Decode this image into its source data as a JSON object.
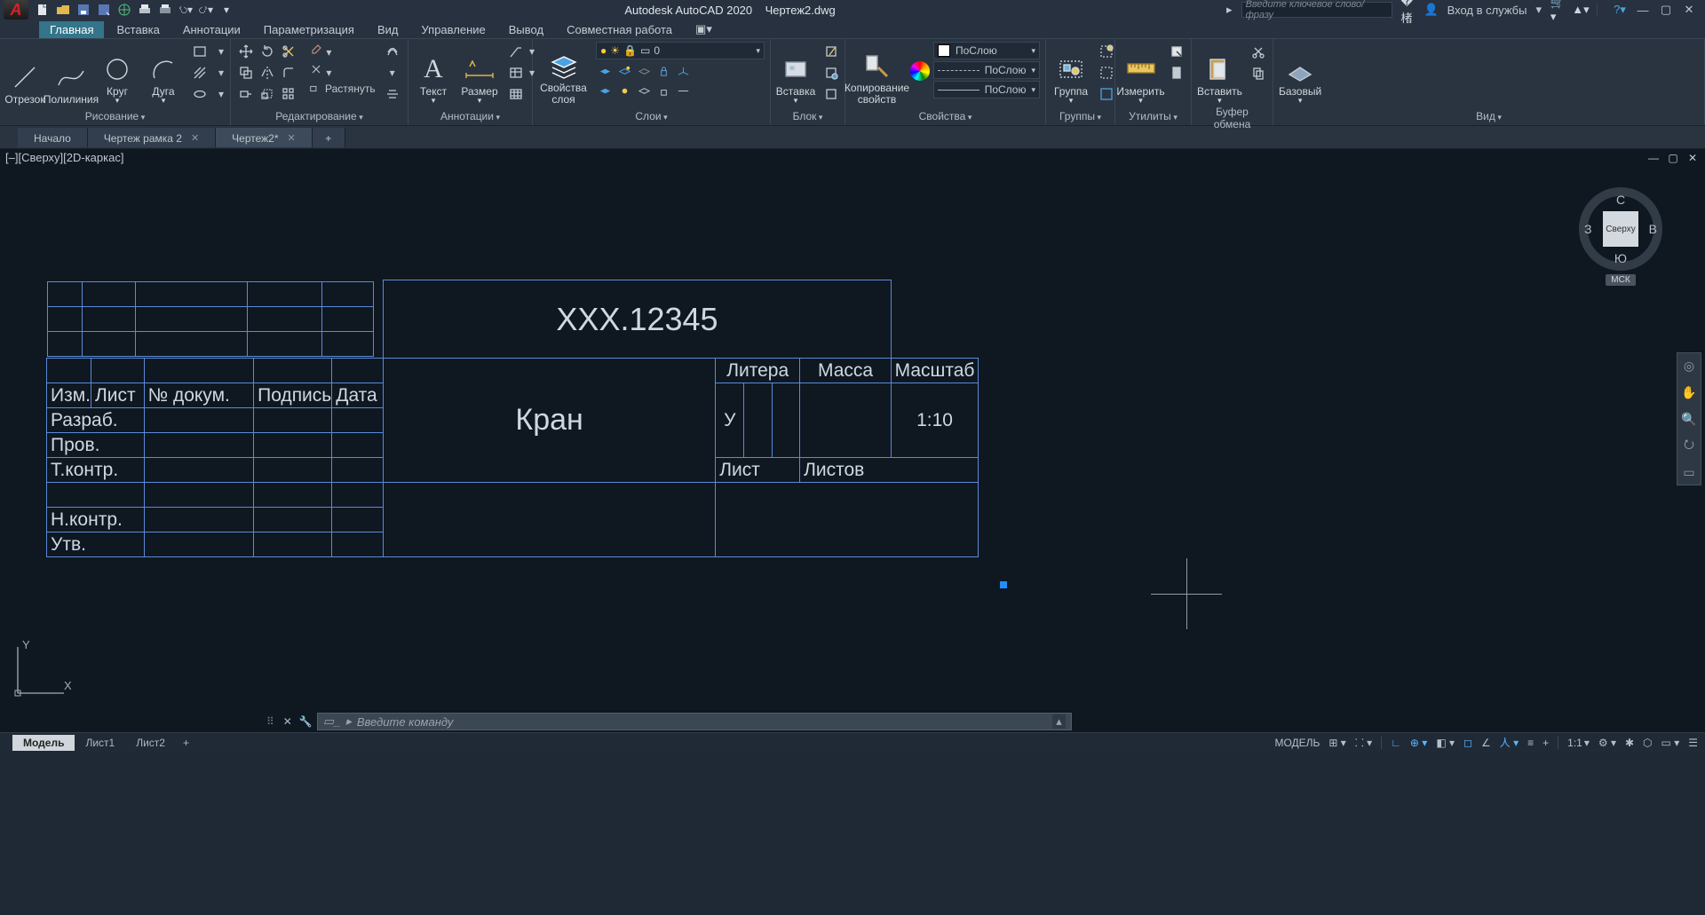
{
  "app": {
    "name": "Autodesk AutoCAD 2020",
    "file": "Чертеж2.dwg"
  },
  "search": {
    "placeholder": "Введите ключевое слово/фразу",
    "login": "Вход в службы"
  },
  "ribbon_tabs": [
    "Главная",
    "Вставка",
    "Аннотации",
    "Параметризация",
    "Вид",
    "Управление",
    "Вывод",
    "Совместная работа"
  ],
  "panels": {
    "draw": {
      "title": "Рисование",
      "line": "Отрезок",
      "pline": "Полилиния",
      "circle": "Круг",
      "arc": "Дуга"
    },
    "edit": {
      "title": "Редактирование",
      "stretch": "Растянуть"
    },
    "anno": {
      "title": "Аннотации",
      "text": "Текст",
      "dim": "Размер"
    },
    "layers": {
      "title": "Слои",
      "props": "Свойства слоя",
      "cur": "0"
    },
    "block": {
      "title": "Блок",
      "insert": "Вставка"
    },
    "props": {
      "title": "Свойства",
      "match": "Копирование свойств",
      "bylayer": "ПоСлою"
    },
    "groups": {
      "title": "Группы",
      "group": "Группа"
    },
    "utils": {
      "title": "Утилиты",
      "measure": "Измерить"
    },
    "clip": {
      "title": "Буфер обмена",
      "paste": "Вставить"
    },
    "view": {
      "title": "Вид",
      "base": "Базовый"
    }
  },
  "doctabs": {
    "start": "Начало",
    "t1": "Чертеж рамка 2",
    "t2": "Чертеж2*"
  },
  "viewport": {
    "label": "[–][Сверху][2D-каркас]",
    "cube": {
      "top": "Сверху",
      "n": "С",
      "s": "Ю",
      "w": "З",
      "e": "В",
      "wcs": "МСК"
    }
  },
  "titleblock": {
    "code": "XXX.12345",
    "name": "Кран",
    "izm": "Изм.",
    "list": "Лист",
    "docno": "№ докум.",
    "sign": "Подпись",
    "date": "Дата",
    "razrab": "Разраб.",
    "prov": "Пров.",
    "tkontr": "Т.контр.",
    "nkontr": "Н.контр.",
    "utv": "Утв.",
    "litera": "Литера",
    "massa": "Масса",
    "scale": "Масштаб",
    "scaleval": "1:10",
    "lit_u": "У",
    "sheet": "Лист",
    "sheets": "Листов"
  },
  "cmd": {
    "placeholder": "Введите команду"
  },
  "layouts": {
    "model": "Модель",
    "l1": "Лист1",
    "l2": "Лист2"
  },
  "status": {
    "model": "МОДЕЛЬ",
    "scale": "1:1"
  }
}
